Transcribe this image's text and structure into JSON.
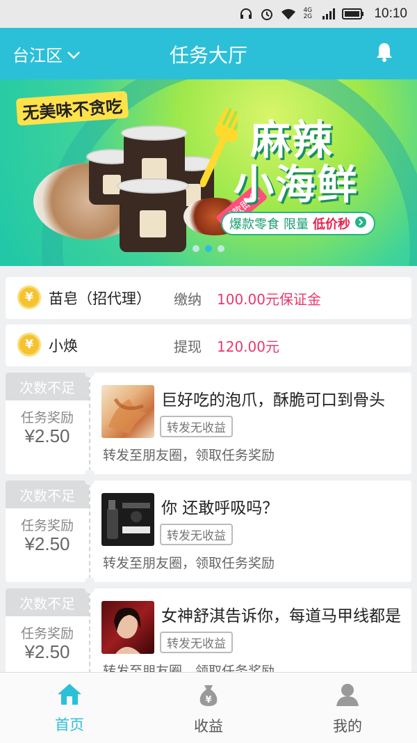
{
  "status_bar": {
    "network": "4G 2G",
    "time": "10:10"
  },
  "header": {
    "region": "台江区",
    "title": "任务大厅"
  },
  "banner": {
    "slogan": "无美味不贪吃",
    "hot_tag": "爆款即食",
    "title_line1": "麻辣",
    "title_line2": "小海鲜",
    "promo_1": "爆款零食",
    "promo_2": "限量",
    "promo_3": "低价秒",
    "colors": {
      "accent": "#2cc0d8",
      "green": "#22b487",
      "red": "#e8214e"
    }
  },
  "notices": [
    {
      "name": "苗皂（招代理）",
      "action": "缴纳",
      "amount": "100.00元保证金"
    },
    {
      "name": "小焕",
      "action": "提现",
      "amount": "120.00元"
    }
  ],
  "coin_symbol": "¥",
  "tasks": [
    {
      "status": "次数不足",
      "reward_label": "任务奖励",
      "reward": "¥2.50",
      "title": "巨好吃的泡爪，酥脆可口到骨头",
      "tag": "转发无收益",
      "desc": "转发至朋友圈，领取任务奖励"
    },
    {
      "status": "次数不足",
      "reward_label": "任务奖励",
      "reward": "¥2.50",
      "title": "你 还敢呼吸吗？",
      "tag": "转发无收益",
      "desc": "转发至朋友圈，领取任务奖励"
    },
    {
      "status": "次数不足",
      "reward_label": "任务奖励",
      "reward": "¥2.50",
      "title": "女神舒淇告诉你，每道马甲线都是",
      "tag": "转发无收益",
      "desc": "转发至朋友圈，领取任务奖励"
    }
  ],
  "bottom_nav": [
    {
      "label": "首页",
      "icon": "home-icon",
      "active": true
    },
    {
      "label": "收益",
      "icon": "money-bag-icon",
      "active": false
    },
    {
      "label": "我的",
      "icon": "user-icon",
      "active": false
    }
  ]
}
